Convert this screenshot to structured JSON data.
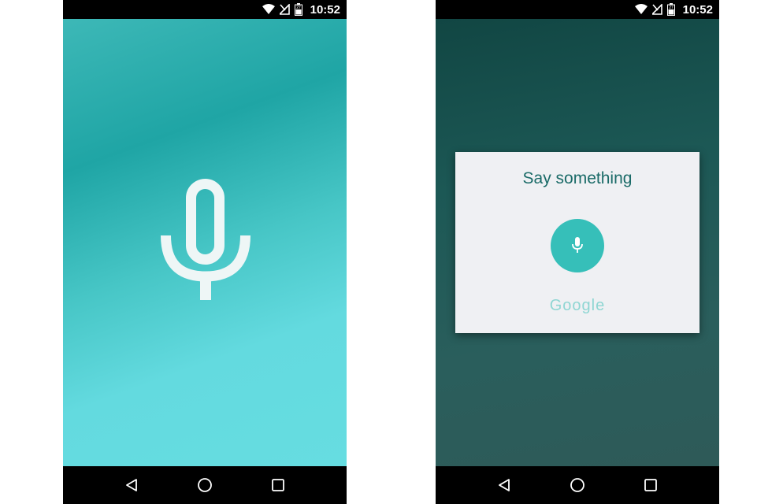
{
  "status_bar": {
    "time": "10:52",
    "icons": [
      "wifi-icon",
      "signal-off-icon",
      "battery-icon"
    ],
    "battery_level": "27"
  },
  "left_screen": {
    "background_colors": [
      "#3db8b7",
      "#1fa5a5",
      "#66dde1"
    ],
    "mic_icon": "microphone-icon",
    "mic_color": "#eef6f6"
  },
  "right_screen": {
    "background_colors": [
      "#114643",
      "#2e5a58"
    ],
    "dialog": {
      "title": "Say something",
      "mic_icon": "microphone-icon",
      "accent_color": "#36bfb9",
      "brand": "Google"
    }
  },
  "nav_bar": {
    "icons": [
      "back-icon",
      "home-icon",
      "recents-icon"
    ]
  }
}
